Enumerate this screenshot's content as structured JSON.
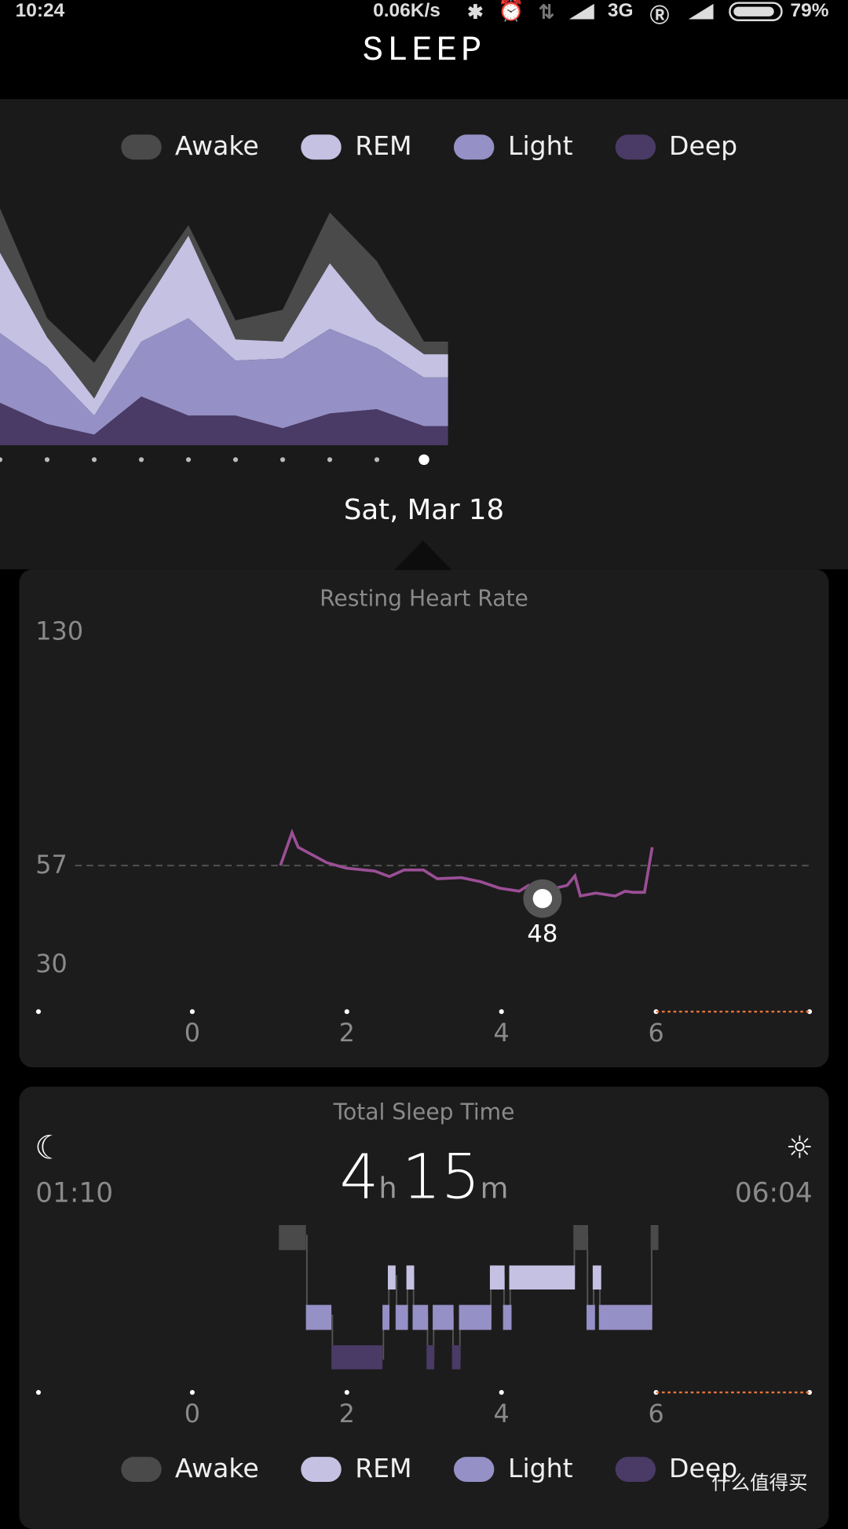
{
  "status_bar": {
    "time": "10:24",
    "net_speed": "0.06K/s",
    "network": "3G",
    "battery": "79%",
    "battery_level": 0.79,
    "icons": [
      "bluetooth-icon",
      "alarm-icon",
      "data-arrows-icon",
      "signal-icon",
      "roaming-icon",
      "signal-icon",
      "battery-icon"
    ]
  },
  "header": {
    "title": "SLEEP"
  },
  "legend": [
    {
      "label": "Awake",
      "color": "#4a4a4a"
    },
    {
      "label": "REM",
      "color": "#c5c1e3"
    },
    {
      "label": "Light",
      "color": "#9590c5"
    },
    {
      "label": "Deep",
      "color": "#4a3a66"
    }
  ],
  "chart_data": [
    {
      "type": "area",
      "stacked": true,
      "unit": "hours (estimated, unlabeled)",
      "series": [
        {
          "name": "Deep",
          "color": "#4a3a66",
          "values": [
            2.0,
            1.0,
            0.5,
            2.3,
            1.4,
            1.4,
            0.8,
            1.5,
            1.7,
            0.9
          ]
        },
        {
          "name": "Light",
          "color": "#9590c5",
          "values": [
            3.3,
            2.7,
            0.9,
            2.6,
            4.6,
            2.6,
            3.3,
            4.0,
            2.9,
            2.3
          ]
        },
        {
          "name": "REM",
          "color": "#c5c1e3",
          "values": [
            3.8,
            1.4,
            0.8,
            1.5,
            3.9,
            1.0,
            0.8,
            3.1,
            1.3,
            1.1
          ]
        },
        {
          "name": "Awake",
          "color": "#4a4a4a",
          "values": [
            2.1,
            0.9,
            1.7,
            0.8,
            0.5,
            0.9,
            1.5,
            2.4,
            2.8,
            0.6
          ]
        }
      ],
      "selected_index": 9,
      "selected_label": "Sat, Mar 18"
    },
    {
      "type": "line",
      "title": "Resting Heart Rate",
      "y_ticks": [
        "130",
        "57",
        "30"
      ],
      "ylim": [
        30,
        130
      ],
      "reference_line": 57,
      "x_ticks": [
        "0",
        "2",
        "4",
        "6"
      ],
      "color": "#9b4f96",
      "x": [
        1.14,
        1.29,
        1.37,
        1.74,
        1.99,
        2.36,
        2.55,
        2.74,
        2.99,
        3.17,
        3.48,
        3.73,
        3.98,
        4.23,
        4.35,
        4.53,
        4.73,
        4.85,
        4.95,
        5.02,
        5.22,
        5.47,
        5.6,
        5.7,
        5.85,
        5.95
      ],
      "y": [
        57,
        66,
        62,
        57.8,
        56.3,
        55.5,
        54,
        55.8,
        55.8,
        53.4,
        53.7,
        52.6,
        50.8,
        50,
        51.6,
        48,
        51,
        51.6,
        54.2,
        48.7,
        49.5,
        48.7,
        50,
        49.7,
        49.7,
        62
      ],
      "min_marker": {
        "x": 4.53,
        "value": "48"
      },
      "dotted_range": [
        6,
        8
      ],
      "dotted_color": "#e8743b"
    },
    {
      "type": "hypnogram",
      "title": "Total Sleep Time",
      "x_ticks": [
        "0",
        "2",
        "4",
        "6"
      ],
      "segments": [
        {
          "stage": "Awake",
          "start": 1.12,
          "end": 1.47
        },
        {
          "stage": "Light",
          "start": 1.47,
          "end": 1.8
        },
        {
          "stage": "Deep",
          "start": 1.8,
          "end": 2.46
        },
        {
          "stage": "Light",
          "start": 2.46,
          "end": 2.55
        },
        {
          "stage": "REM",
          "start": 2.53,
          "end": 2.63
        },
        {
          "stage": "Light",
          "start": 2.63,
          "end": 2.79
        },
        {
          "stage": "REM",
          "start": 2.77,
          "end": 2.87
        },
        {
          "stage": "Light",
          "start": 2.85,
          "end": 3.05
        },
        {
          "stage": "Deep",
          "start": 3.03,
          "end": 3.13
        },
        {
          "stage": "Light",
          "start": 3.11,
          "end": 3.38
        },
        {
          "stage": "Deep",
          "start": 3.36,
          "end": 3.47
        },
        {
          "stage": "Light",
          "start": 3.45,
          "end": 3.87
        },
        {
          "stage": "REM",
          "start": 3.85,
          "end": 4.04
        },
        {
          "stage": "Light",
          "start": 4.02,
          "end": 4.13
        },
        {
          "stage": "REM",
          "start": 4.1,
          "end": 4.95
        },
        {
          "stage": "Awake",
          "start": 4.93,
          "end": 5.12
        },
        {
          "stage": "Light",
          "start": 5.1,
          "end": 5.21
        },
        {
          "stage": "REM",
          "start": 5.18,
          "end": 5.29
        },
        {
          "stage": "Light",
          "start": 5.26,
          "end": 5.95
        },
        {
          "stage": "Awake",
          "start": 5.93,
          "end": 6.03
        }
      ]
    }
  ],
  "sleep_summary": {
    "bedtime": "01:10",
    "wake_time": "06:04",
    "hours": "4",
    "hours_unit": "h",
    "minutes": "15",
    "minutes_unit": "m",
    "bed_icon": "moon-icon",
    "wake_icon": "sun-icon"
  },
  "watermark": "什么值得买"
}
